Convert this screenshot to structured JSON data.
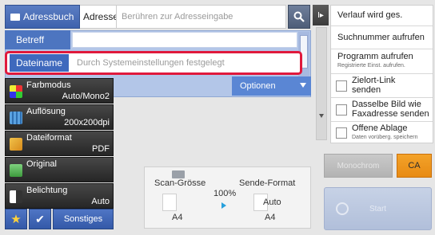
{
  "header": {
    "address_book_label": "Adressbuch",
    "address_label": "Adresse",
    "address_placeholder": "Berühren zur Adresseingabe"
  },
  "fields": {
    "subject_label": "Betreff",
    "subject_value": "",
    "filename_label": "Dateiname",
    "filename_placeholder": "Durch Systemeinstellungen festgelegt",
    "options_label": "Optionen"
  },
  "settings": [
    {
      "label": "Farbmodus",
      "value": "Auto/Mono2",
      "icon": "color-mode-icon"
    },
    {
      "label": "Auflösung",
      "value": "200x200dpi",
      "icon": "resolution-icon"
    },
    {
      "label": "Dateiformat",
      "value": "PDF",
      "icon": "file-format-icon"
    },
    {
      "label": "Original",
      "value": "",
      "icon": "original-icon"
    },
    {
      "label": "Belichtung",
      "value": "Auto",
      "icon": "exposure-icon"
    }
  ],
  "bottom": {
    "star_glyph": "★",
    "check_glyph": "✔",
    "others_label": "Sonstiges"
  },
  "preview": {
    "scan_size_label": "Scan-Grösse",
    "send_format_label": "Sende-Format",
    "ratio": "100%",
    "send_auto": "Auto",
    "scan_paper": "A4",
    "send_paper": "A4"
  },
  "sidebar": {
    "tab_glyph": "I▸",
    "items": [
      {
        "label": "Verlauf wird ges.",
        "sub": "",
        "checkbox": false
      },
      {
        "label": "Suchnummer aufrufen",
        "sub": "",
        "checkbox": false
      },
      {
        "label": "Programm aufrufen",
        "sub": "Registrierte Einst. aufrufen.",
        "checkbox": false
      },
      {
        "label": "Zielort-Link\nsenden",
        "sub": "",
        "checkbox": true
      },
      {
        "label": "Dasselbe Bild wie\nFaxadresse senden",
        "sub": "",
        "checkbox": true
      },
      {
        "label": "Offene Ablage",
        "sub": "Daten vorüberg. speichern",
        "checkbox": true
      }
    ]
  },
  "actions": {
    "bw_start_label": "Monochrom",
    "ca_label": "CA",
    "color_start_label": "Start"
  },
  "colors": {
    "accent_blue": "#3e62ad",
    "highlight_red": "#e0193c",
    "ca_orange": "#f0981f"
  }
}
